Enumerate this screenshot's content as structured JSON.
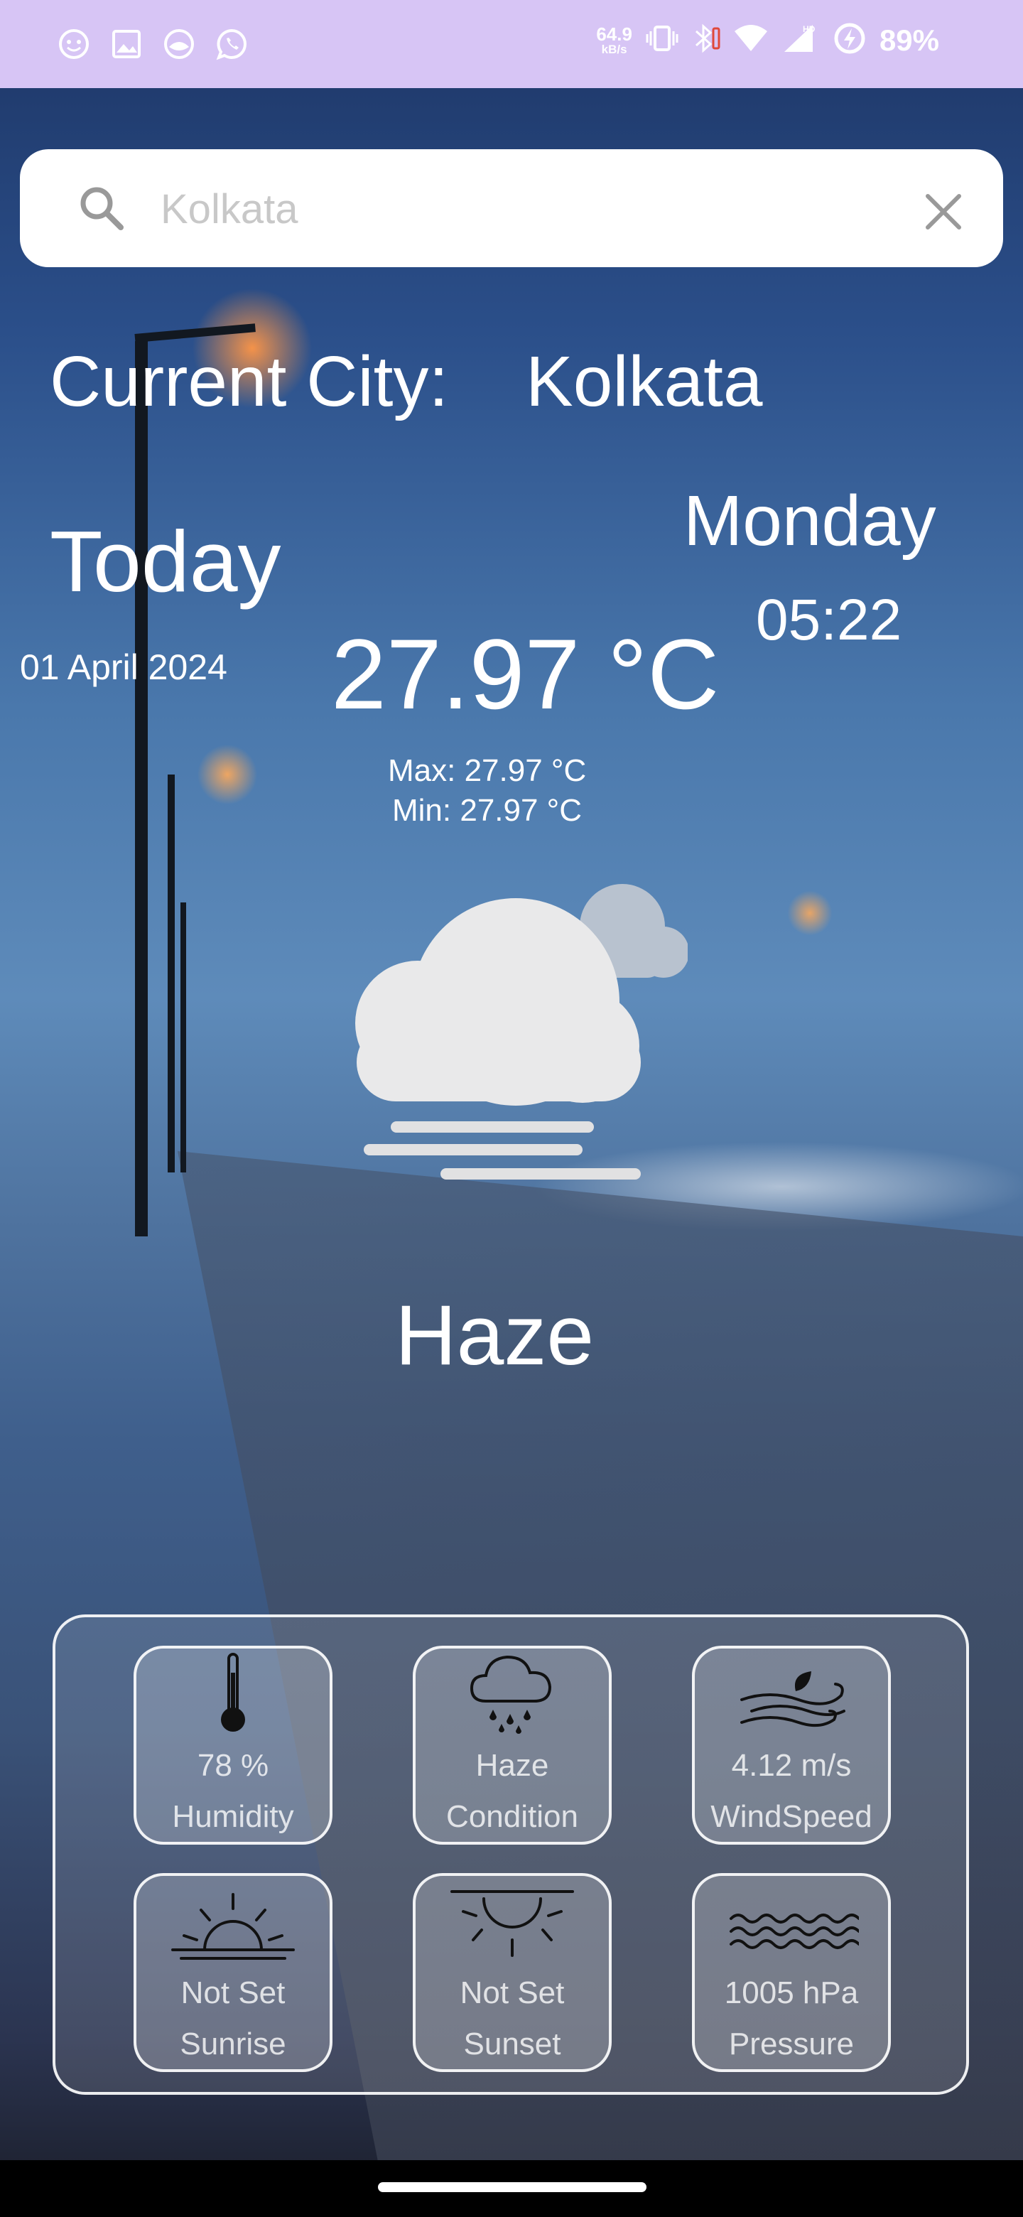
{
  "status_bar": {
    "net_speed_value": "64.9",
    "net_speed_unit": "kB/s",
    "battery": "89%",
    "notification_icons": [
      "face-icon",
      "gallery-icon",
      "app-icon",
      "whatsapp-icon"
    ],
    "system_icons": [
      "vibrate-icon",
      "bluetooth-icon",
      "wifi-icon",
      "signal-hd-icon",
      "battery-saver-icon"
    ],
    "background_color": "#d7c5f5"
  },
  "search": {
    "placeholder": "Kolkata",
    "value": ""
  },
  "location": {
    "label": "Current City:",
    "city": "Kolkata"
  },
  "date": {
    "today_label": "Today",
    "full_date": "01 April 2024",
    "weekday": "Monday",
    "time": "05:22"
  },
  "weather": {
    "temperature": "27.97 °C",
    "max": "Max: 27.97 °C",
    "min": "Min: 27.97 °C",
    "condition": "Haze",
    "icon": "haze-cloud-icon"
  },
  "details": [
    {
      "value": "78 %",
      "label": "Humidity",
      "icon": "thermometer-icon"
    },
    {
      "value": "Haze",
      "label": "Condition",
      "icon": "rain-cloud-icon"
    },
    {
      "value": "4.12 m/s",
      "label": "WindSpeed",
      "icon": "wind-icon"
    },
    {
      "value": "Not Set",
      "label": "Sunrise",
      "icon": "sunrise-icon"
    },
    {
      "value": "Not Set",
      "label": "Sunset",
      "icon": "sunset-icon"
    },
    {
      "value": "1005 hPa",
      "label": "Pressure",
      "icon": "waves-icon"
    }
  ]
}
